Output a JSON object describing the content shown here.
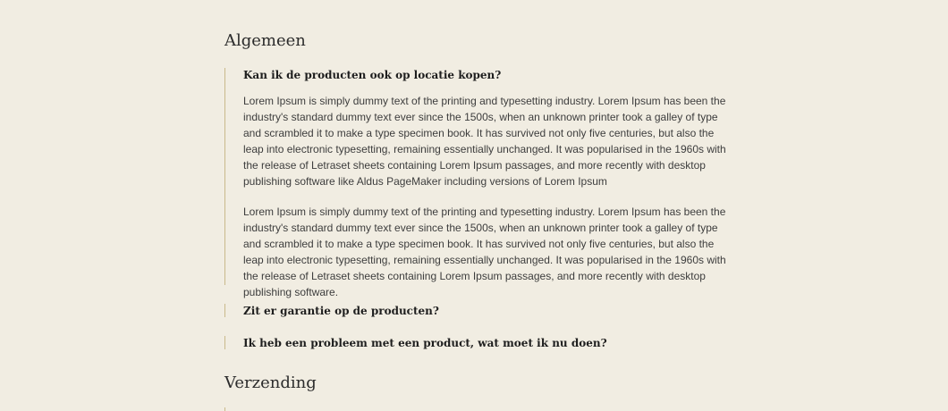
{
  "sections": [
    {
      "title": "Algemeen",
      "faqs": [
        {
          "question": "Kan ik de producten ook op locatie kopen?",
          "answer_paragraphs": [
            "Lorem Ipsum is simply dummy text of the printing and typesetting industry. Lorem Ipsum has been the industry's standard dummy text ever since the 1500s, when an unknown printer took a galley of type and scrambled it to make a type specimen book. It has survived not only five centuries, but also the leap into electronic typesetting, remaining essentially unchanged. It was popularised in the 1960s with the release of Letraset sheets containing Lorem Ipsum passages, and more recently with desktop publishing software like Aldus PageMaker including versions of Lorem Ipsum",
            "Lorem Ipsum is simply dummy text of the printing and typesetting industry. Lorem Ipsum has been the industry's standard dummy text ever since the 1500s, when an unknown printer took a galley of type and scrambled it to make a type specimen book. It has survived not only five centuries, but also the leap into electronic typesetting, remaining essentially unchanged. It was popularised in the 1960s with the release of Letraset sheets containing Lorem Ipsum passages, and more recently with desktop publishing software."
          ]
        },
        {
          "question": "Zit er garantie op de producten?"
        },
        {
          "question": "Ik heb een probleem met een product, wat moet ik nu doen?"
        }
      ]
    },
    {
      "title": "Verzending"
    }
  ],
  "colors": {
    "background": "#f1ede2",
    "accent_border": "#c9b98a",
    "text": "#3d3d3d",
    "heading": "#2c2c2c"
  }
}
